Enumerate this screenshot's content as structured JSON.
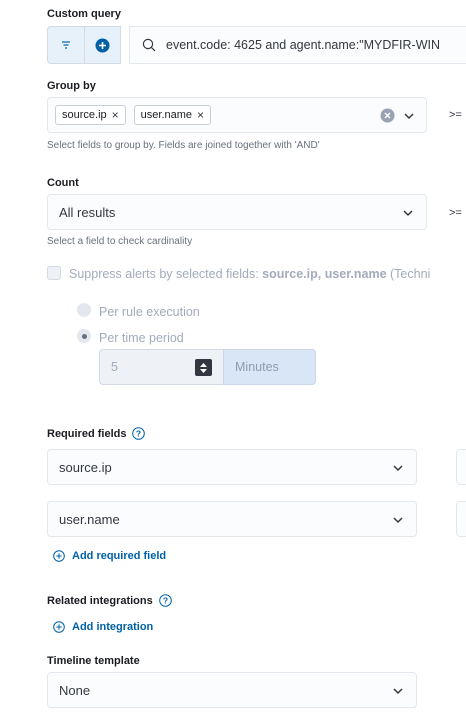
{
  "custom_query": {
    "label": "Custom query",
    "query_text": "event.code: 4625 and agent.name:\"MYDFIR-WIN"
  },
  "group_by": {
    "label": "Group by",
    "chips": [
      "source.ip",
      "user.name"
    ],
    "help": "Select fields to group by. Fields are joined together with 'AND'",
    "threshold_op": ">="
  },
  "count": {
    "label": "Count",
    "value": "All results",
    "help": "Select a field to check cardinality",
    "threshold_op": ">="
  },
  "suppress": {
    "prefix": "Suppress alerts by selected fields:",
    "fields": "source.ip, user.name",
    "suffix": "(Techni",
    "options": [
      "Per rule execution",
      "Per time period"
    ],
    "duration_value": "5",
    "duration_unit": "Minutes"
  },
  "required_fields": {
    "label": "Required fields",
    "rows": [
      "source.ip",
      "user.name"
    ],
    "add_label": "Add required field"
  },
  "related_integrations": {
    "label": "Related integrations",
    "add_label": "Add integration"
  },
  "timeline_template": {
    "label": "Timeline template",
    "value": "None"
  },
  "colors": {
    "accent": "#0061a6",
    "disabled": "#a2abba"
  }
}
